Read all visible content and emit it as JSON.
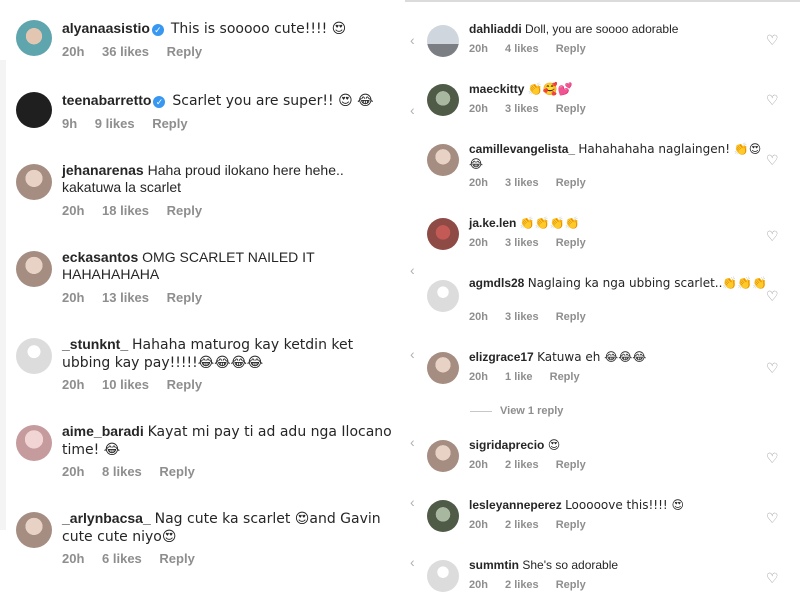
{
  "left_comments": [
    {
      "user": "alyanaasistio",
      "verified": true,
      "text": "This is sooooo cute!!!! 😍",
      "time": "20h",
      "likes": "36 likes",
      "reply": "Reply"
    },
    {
      "user": "teenabarretto",
      "verified": true,
      "text": "Scarlet you are super!! 😍 😂",
      "time": "9h",
      "likes": "9 likes",
      "reply": "Reply"
    },
    {
      "user": "jehanarenas",
      "verified": false,
      "text": "Haha proud ilokano here hehe.. kakatuwa la scarlet",
      "time": "20h",
      "likes": "18 likes",
      "reply": "Reply"
    },
    {
      "user": "eckasantos",
      "verified": false,
      "text": "OMG SCARLET NAILED IT HAHAHAHAHA",
      "time": "20h",
      "likes": "13 likes",
      "reply": "Reply"
    },
    {
      "user": "_stunknt_",
      "verified": false,
      "text": "Hahaha maturog kay ketdin ket ubbing kay pay!!!!!😂😂😂😂",
      "time": "20h",
      "likes": "10 likes",
      "reply": "Reply"
    },
    {
      "user": "aime_baradi",
      "verified": false,
      "text": "Kayat mi pay ti ad adu nga Ilocano time! 😂",
      "time": "20h",
      "likes": "8 likes",
      "reply": "Reply"
    },
    {
      "user": "_arlynbacsa_",
      "verified": false,
      "text": "Nag cute ka scarlet 😍and Gavin cute cute niyo😍",
      "time": "20h",
      "likes": "6 likes",
      "reply": "Reply"
    }
  ],
  "right_comments": [
    {
      "user": "dahliaddi",
      "text": "Doll, you are soooo adorable",
      "time": "20h",
      "likes": "4 likes",
      "reply": "Reply"
    },
    {
      "user": "maeckitty",
      "text": "👏🥰💕",
      "time": "20h",
      "likes": "3 likes",
      "reply": "Reply"
    },
    {
      "user": "camillevangelista_",
      "text": "Hahahahaha naglaingen! 👏😍😂",
      "time": "20h",
      "likes": "3 likes",
      "reply": "Reply"
    },
    {
      "user": "ja.ke.len",
      "text": "👏👏👏👏",
      "time": "20h",
      "likes": "3 likes",
      "reply": "Reply"
    },
    {
      "user": "agmdls28",
      "text": "Naglaing ka nga ubbing scarlet..👏👏👏",
      "time": "20h",
      "likes": "3 likes",
      "reply": "Reply"
    },
    {
      "user": "elizgrace17",
      "text": "Katuwa eh 😂😂😂",
      "time": "20h",
      "likes": "1 like",
      "reply": "Reply"
    },
    {
      "user": "sigridaprecio",
      "text": "😍",
      "time": "20h",
      "likes": "2 likes",
      "reply": "Reply"
    },
    {
      "user": "lesleyanneperez",
      "text": "Looooove this!!!! 😍",
      "time": "20h",
      "likes": "2 likes",
      "reply": "Reply"
    },
    {
      "user": "summtin",
      "text": "She's so adorable",
      "time": "20h",
      "likes": "2 likes",
      "reply": "Reply"
    }
  ],
  "view_replies": "View 1 reply",
  "icons": {
    "heart": "heart-outline-icon",
    "chevron": "chevron-left-icon",
    "verified": "verified-badge-icon"
  },
  "colors": {
    "verified_blue": "#3897f0",
    "meta_gray": "#8e8e8e",
    "text": "#262626"
  }
}
